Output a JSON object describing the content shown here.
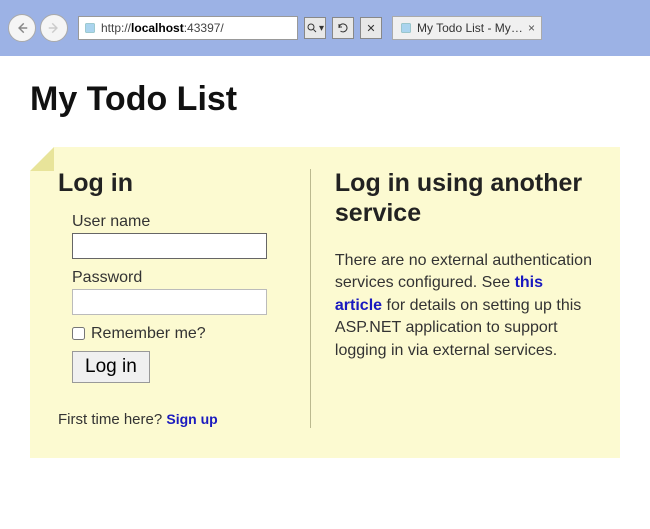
{
  "browser": {
    "url_prefix": "http://",
    "url_host": "localhost",
    "url_port": ":43397/",
    "tab_title": "My Todo List - My A..."
  },
  "page": {
    "title": "My Todo List"
  },
  "login": {
    "heading": "Log in",
    "username_label": "User name",
    "username_value": "",
    "password_label": "Password",
    "password_value": "",
    "remember_label": "Remember me?",
    "submit_label": "Log in",
    "signup_prefix": "First time here? ",
    "signup_link": "Sign up"
  },
  "external": {
    "heading": "Log in using another service",
    "text_before": "There are no external authentication services configured. See ",
    "link_text": "this article",
    "text_after": " for details on setting up this ASP.NET application to support logging in via external services."
  }
}
